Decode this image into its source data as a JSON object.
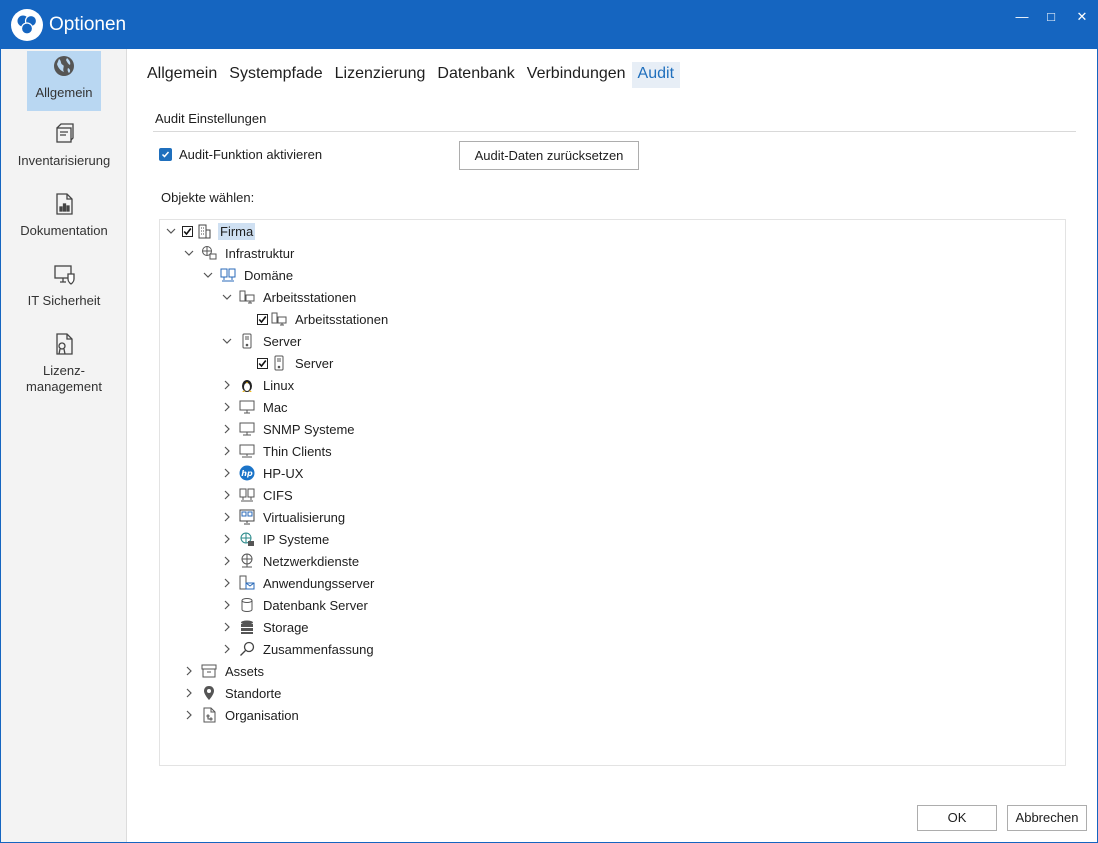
{
  "window": {
    "title": "Optionen",
    "accent": "#1565c0",
    "controls": {
      "minimize": "—",
      "maximize": "□",
      "close": "✕"
    }
  },
  "sidebar": {
    "items": [
      {
        "label": "Allgemein",
        "icon": "globe-icon",
        "active": true
      },
      {
        "label": "Inventarisierung",
        "icon": "inventory-icon"
      },
      {
        "label": "Dokumentation",
        "icon": "document-chart-icon"
      },
      {
        "label": "IT Sicherheit",
        "icon": "shield-monitor-icon"
      },
      {
        "label_line1": "Lizenz-",
        "label_line2": "management",
        "icon": "license-document-icon"
      }
    ]
  },
  "tabs": [
    "Allgemein",
    "Systempfade",
    "Lizenzierung",
    "Datenbank",
    "Verbindungen",
    "Audit"
  ],
  "active_tab": "Audit",
  "audit": {
    "section_title": "Audit Einstellungen",
    "enable_label": "Audit-Funktion aktivieren",
    "enable_checked": true,
    "reset_button": "Audit-Daten zurücksetzen",
    "objects_label": "Objekte wählen:"
  },
  "tree": [
    {
      "label": "Firma",
      "icon": "building-icon",
      "expanded": true,
      "checkbox": true,
      "checked": true,
      "selected": true
    },
    {
      "label": "Infrastruktur",
      "icon": "network-icon",
      "expanded": true
    },
    {
      "label": "Domäne",
      "icon": "domain-icon",
      "expanded": true
    },
    {
      "label": "Arbeitsstationen",
      "icon": "workstations-icon",
      "expanded": true
    },
    {
      "label": "Arbeitsstationen",
      "icon": "workstations-icon",
      "checkbox": true,
      "checked": true
    },
    {
      "label": "Server",
      "icon": "server-icon",
      "expanded": true
    },
    {
      "label": "Server",
      "icon": "server-icon",
      "checkbox": true,
      "checked": true
    },
    {
      "label": "Linux",
      "icon": "linux-icon"
    },
    {
      "label": "Mac",
      "icon": "mac-icon"
    },
    {
      "label": "SNMP Systeme",
      "icon": "snmp-icon"
    },
    {
      "label": "Thin Clients",
      "icon": "thin-client-icon"
    },
    {
      "label": "HP-UX",
      "icon": "hp-icon"
    },
    {
      "label": "CIFS",
      "icon": "cifs-icon"
    },
    {
      "label": "Virtualisierung",
      "icon": "virtualization-icon"
    },
    {
      "label": "IP Systeme",
      "icon": "ip-systems-icon"
    },
    {
      "label": "Netzwerkdienste",
      "icon": "network-services-icon"
    },
    {
      "label": "Anwendungsserver",
      "icon": "application-server-icon"
    },
    {
      "label": "Datenbank Server",
      "icon": "database-icon"
    },
    {
      "label": "Storage",
      "icon": "storage-icon"
    },
    {
      "label": "Zusammenfassung",
      "icon": "search-icon"
    },
    {
      "label": "Assets",
      "icon": "box-icon"
    },
    {
      "label": "Standorte",
      "icon": "location-pin-icon"
    },
    {
      "label": "Organisation",
      "icon": "org-chart-icon"
    }
  ],
  "footer": {
    "ok": "OK",
    "cancel": "Abbrechen"
  }
}
